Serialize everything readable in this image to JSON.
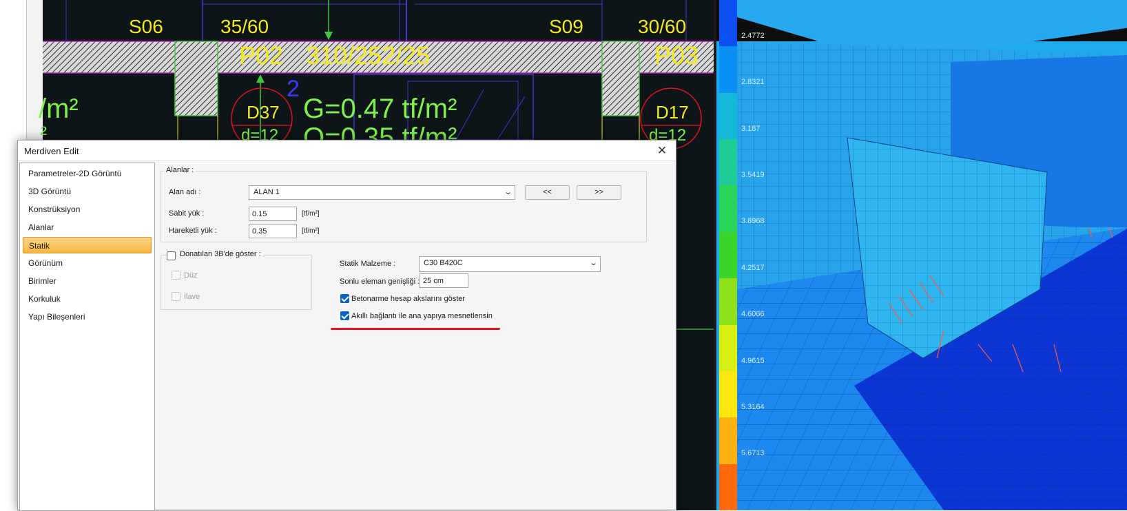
{
  "cad": {
    "labels": {
      "s06": "S06",
      "col1": "35/60",
      "s09": "S09",
      "col2": "30/60",
      "p02": "P02",
      "beam": "310/252/25",
      "p03": "P03",
      "tfm_left": "/m²",
      "left_2": "²",
      "num2": "2",
      "d37": "D37",
      "d37_sub": "d=12",
      "g_load": "G=0.47 tf/m²",
      "q_load": "Q=0.35 tf/m²",
      "d17": "D17",
      "d17_sub": "d=12"
    }
  },
  "fem": {
    "legend_values": [
      "2.4772",
      "2.8321",
      "3.187",
      "3.5419",
      "3.8968",
      "4.2517",
      "4.6066",
      "4.9615",
      "5.3164",
      "5.6713"
    ],
    "legend_colors": [
      "#0d4ff0",
      "#0a8ff2",
      "#14b9d8",
      "#1fcc99",
      "#2bd45a",
      "#3ad42b",
      "#8ee019",
      "#d8ef12",
      "#ffe80f",
      "#ffb20f",
      "#ff6a0f"
    ]
  },
  "dialog": {
    "title": "Merdiven Edit",
    "close_glyph": "✕",
    "nav": [
      "Parametreler-2D Görüntü",
      "3D Görüntü",
      "Konstrüksiyon",
      "Alanlar",
      "Statik",
      "Görünüm",
      "Birimler",
      "Korkuluk",
      "Yapı Bileşenleri"
    ],
    "active_nav": "Statik",
    "alanlar": {
      "group_title": "Alanlar :",
      "alan_adi_label": "Alan adı :",
      "alan_adi_value": "ALAN 1",
      "prev_button": "<<",
      "next_button": ">>",
      "sabit_label": "Sabit yük :",
      "sabit_value": "0.15",
      "sabit_unit": "[tf/m²]",
      "hareketli_label": "Hareketli yük :",
      "hareketli_value": "0.35",
      "hareketli_unit": "[tf/m²]"
    },
    "donatilan": {
      "title": "Donatılan 3B'de göster :",
      "checked": false,
      "duz_label": "Düz",
      "ilave_label": "İlave"
    },
    "statik": {
      "malzeme_label": "Statik Malzeme :",
      "malzeme_value": "C30 B420C",
      "sonlu_label": "Sonlu eleman genişliği :",
      "sonlu_value": "25 cm",
      "betonarme_label": "Betonarme hesap akslarını göster",
      "betonarme_checked": true,
      "akilli_label": "Akıllı bağlantı ile ana yapıya mesnetlensin",
      "akilli_checked": true
    }
  }
}
